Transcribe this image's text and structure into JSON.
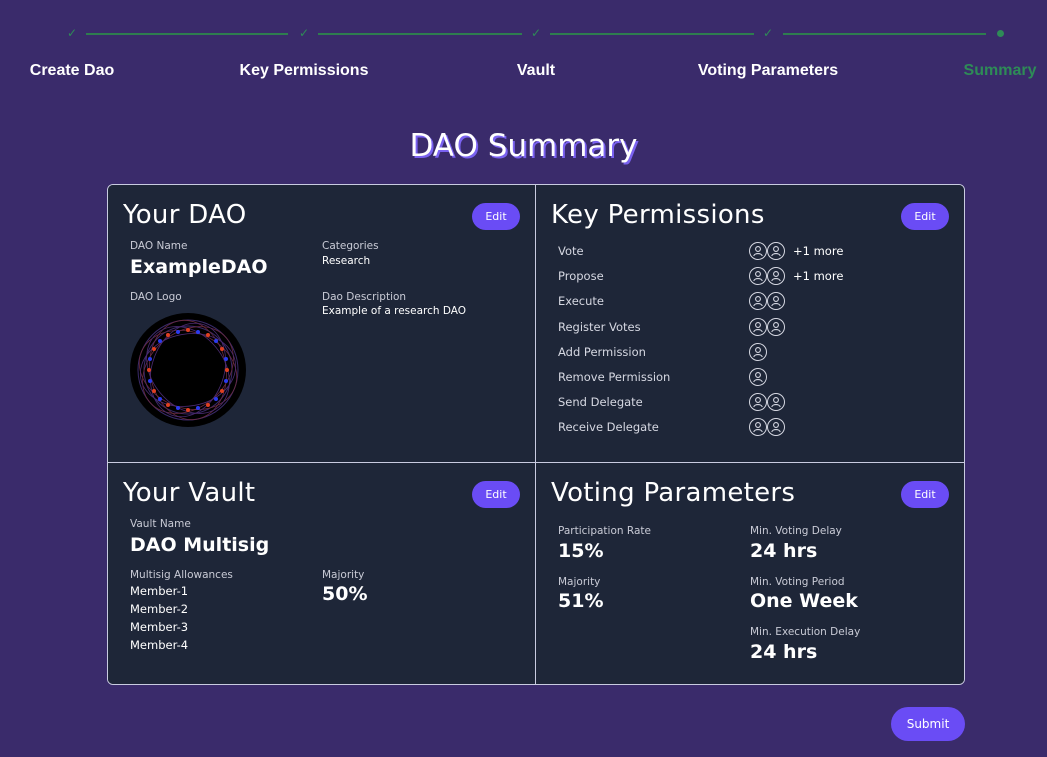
{
  "stepper": {
    "steps": [
      {
        "label": "Create Dao",
        "status": "complete"
      },
      {
        "label": "Key Permissions",
        "status": "complete"
      },
      {
        "label": "Vault",
        "status": "complete"
      },
      {
        "label": "Voting Parameters",
        "status": "complete"
      },
      {
        "label": "Summary",
        "status": "active"
      }
    ]
  },
  "page_title": "DAO Summary",
  "your_dao": {
    "title": "Your DAO",
    "edit_label": "Edit",
    "dao_name_label": "DAO Name",
    "dao_name": "ExampleDAO",
    "categories_label": "Categories",
    "categories": "Research",
    "dao_logo_label": "DAO Logo",
    "description_label": "Dao Description",
    "description": "Example of a research DAO"
  },
  "key_permissions": {
    "title": "Key Permissions",
    "edit_label": "Edit",
    "items": [
      {
        "name": "Vote",
        "avatars": 2,
        "more": "+1 more"
      },
      {
        "name": "Propose",
        "avatars": 2,
        "more": "+1 more"
      },
      {
        "name": "Execute",
        "avatars": 2,
        "more": ""
      },
      {
        "name": "Register Votes",
        "avatars": 2,
        "more": ""
      },
      {
        "name": "Add Permission",
        "avatars": 1,
        "more": ""
      },
      {
        "name": "Remove Permission",
        "avatars": 1,
        "more": ""
      },
      {
        "name": "Send Delegate",
        "avatars": 2,
        "more": ""
      },
      {
        "name": "Receive Delegate",
        "avatars": 2,
        "more": ""
      }
    ]
  },
  "your_vault": {
    "title": "Your Vault",
    "edit_label": "Edit",
    "vault_name_label": "Vault Name",
    "vault_name": "DAO Multisig",
    "allowances_label": "Multisig Allowances",
    "members": [
      "Member-1",
      "Member-2",
      "Member-3",
      "Member-4"
    ],
    "majority_label": "Majority",
    "majority": "50%"
  },
  "voting_parameters": {
    "title": "Voting Parameters",
    "edit_label": "Edit",
    "participation_rate_label": "Participation Rate",
    "participation_rate": "15%",
    "majority_label": "Majority",
    "majority": "51%",
    "min_voting_delay_label": "Min. Voting Delay",
    "min_voting_delay": "24 hrs",
    "min_voting_period_label": "Min. Voting Period",
    "min_voting_period": "One Week",
    "min_execution_delay_label": "Min. Execution Delay",
    "min_execution_delay": "24 hrs"
  },
  "submit_label": "Submit",
  "colors": {
    "background": "#3a2b6b",
    "card": "#1e2638",
    "accent": "#6a4cf5",
    "step_complete": "#2e8b57"
  }
}
